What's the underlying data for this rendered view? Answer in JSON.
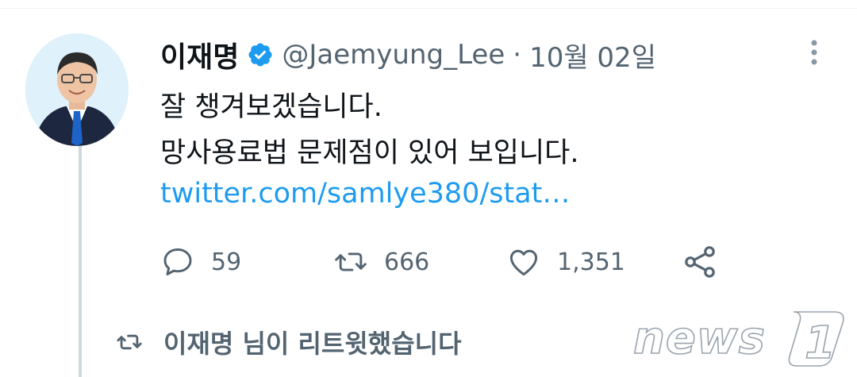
{
  "tweet": {
    "display_name": "이재명",
    "handle": "@Jaemyung_Lee",
    "separator": "·",
    "date": "10월 02일",
    "text_line1": "잘 챙겨보겠습니다.",
    "text_line2": "망사용료법 문제점이 있어 보입니다.",
    "link": "twitter.com/samlye380/stat…"
  },
  "actions": {
    "reply_count": "59",
    "retweet_count": "666",
    "like_count": "1,351"
  },
  "retweet_note": "이재명 님이 리트윗했습니다",
  "watermark": "news1",
  "icons": {
    "verified": "verified-badge-icon",
    "more": "more-vertical-icon",
    "reply": "reply-bubble-icon",
    "retweet": "retweet-icon",
    "like": "heart-icon",
    "share": "share-icon"
  },
  "colors": {
    "accent": "#1d9bf0",
    "muted": "#536471",
    "text": "#0f1419",
    "thread_line": "#cfd9de"
  }
}
